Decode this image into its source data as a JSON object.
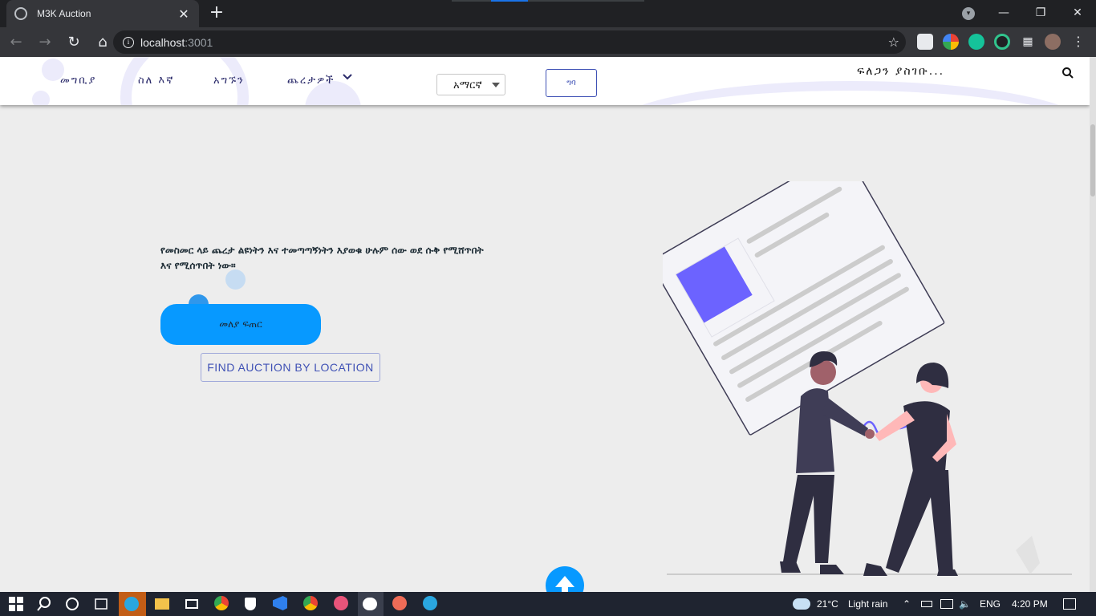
{
  "browser": {
    "tab_title": "M3K Auction",
    "tab_close": "✕",
    "new_tab": "+",
    "url_host": "localhost",
    "url_port": ":3001"
  },
  "nav": {
    "links": [
      "መግቢያ",
      "ስለ እኛ",
      "አግኙን",
      "ጨረታዎች"
    ],
    "language_selected": "አማርኛ",
    "login_label": "ግባ",
    "search_placeholder": "ፍለጋን ያስገቡ..."
  },
  "hero": {
    "description": "የመስመር ላይ ጨረታ ልዩነትን እና ተመጣጣኝነትን እያወቁ ሁሉም ሰው ወደ ሱቅ የሚሸጥበት እና የሚሰጥበት ነው።",
    "create_button": "መለያ ፍጠር",
    "find_button": "FIND AUCTION BY LOCATION"
  },
  "taskbar": {
    "weather_temp": "21°C",
    "weather_text": "Light rain",
    "language": "ENG",
    "time": "4:20 PM"
  },
  "colors": {
    "primary_button": "#0799ff",
    "indigo": "#3f51b5",
    "page_bg": "#ededed",
    "illustration_accent": "#6c63ff"
  }
}
